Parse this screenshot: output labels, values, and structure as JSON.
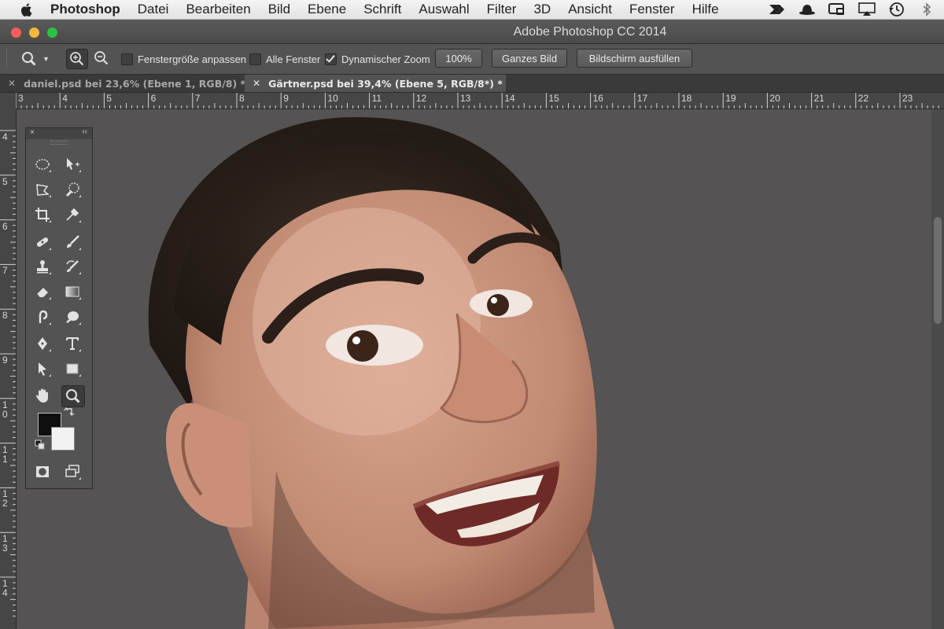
{
  "menubar": {
    "apple_icon": "apple-icon",
    "items": [
      "Photoshop",
      "Datei",
      "Bearbeiten",
      "Bild",
      "Ebene",
      "Schrift",
      "Auswahl",
      "Filter",
      "3D",
      "Ansicht",
      "Fenster",
      "Hilfe"
    ],
    "tray_icons": [
      "arrows-icon",
      "hat-icon",
      "monitor-icon",
      "airplay-icon",
      "time-machine-icon",
      "bluetooth-icon"
    ]
  },
  "window": {
    "title": "Adobe Photoshop CC 2014"
  },
  "options": {
    "fit_window_label": "Fenstergröße anpassen",
    "fit_window_checked": false,
    "all_windows_label": "Alle Fenster",
    "all_windows_checked": false,
    "dynamic_zoom_label": "Dynamischer Zoom",
    "dynamic_zoom_checked": true,
    "btn_100": "100%",
    "btn_fit": "Ganzes Bild",
    "btn_fill": "Bildschirm ausfüllen"
  },
  "tabs": [
    {
      "label": "daniel.psd bei 23,6% (Ebene 1, RGB/8) *",
      "active": false
    },
    {
      "label": "Gärtner.psd bei 39,4% (Ebene 5, RGB/8*) *",
      "active": true
    }
  ],
  "ruler_h": [
    "3",
    "4",
    "5",
    "6",
    "7",
    "8",
    "9",
    "10",
    "11",
    "12",
    "13",
    "14",
    "15",
    "16",
    "17",
    "18",
    "19",
    "20",
    "21",
    "22",
    "23"
  ],
  "ruler_v": [
    "4",
    "5",
    "6",
    "7",
    "8",
    "9",
    "1\n0",
    "1\n1",
    "1\n2",
    "1\n3",
    "1\n4"
  ],
  "tools_panel": {
    "close": "×",
    "collapse": "‹‹",
    "tools": [
      "ellipse-marquee-icon",
      "move-icon",
      "polygonal-lasso-icon",
      "quick-selection-icon",
      "crop-icon",
      "eyedropper-icon",
      "healing-brush-icon",
      "brush-icon",
      "clone-stamp-icon",
      "history-brush-icon",
      "eraser-icon",
      "gradient-icon",
      "smudge-icon",
      "dodge-icon",
      "pen-icon",
      "type-icon",
      "path-selection-icon",
      "rectangle-shape-icon",
      "hand-icon",
      "zoom-icon",
      "quick-mask-icon",
      "screen-mode-icon"
    ],
    "foreground_color": "#0f0f0f",
    "background_color": "#f2f2f2"
  },
  "canvas": {
    "background_color": "#555555",
    "content": "portrait-photo"
  }
}
